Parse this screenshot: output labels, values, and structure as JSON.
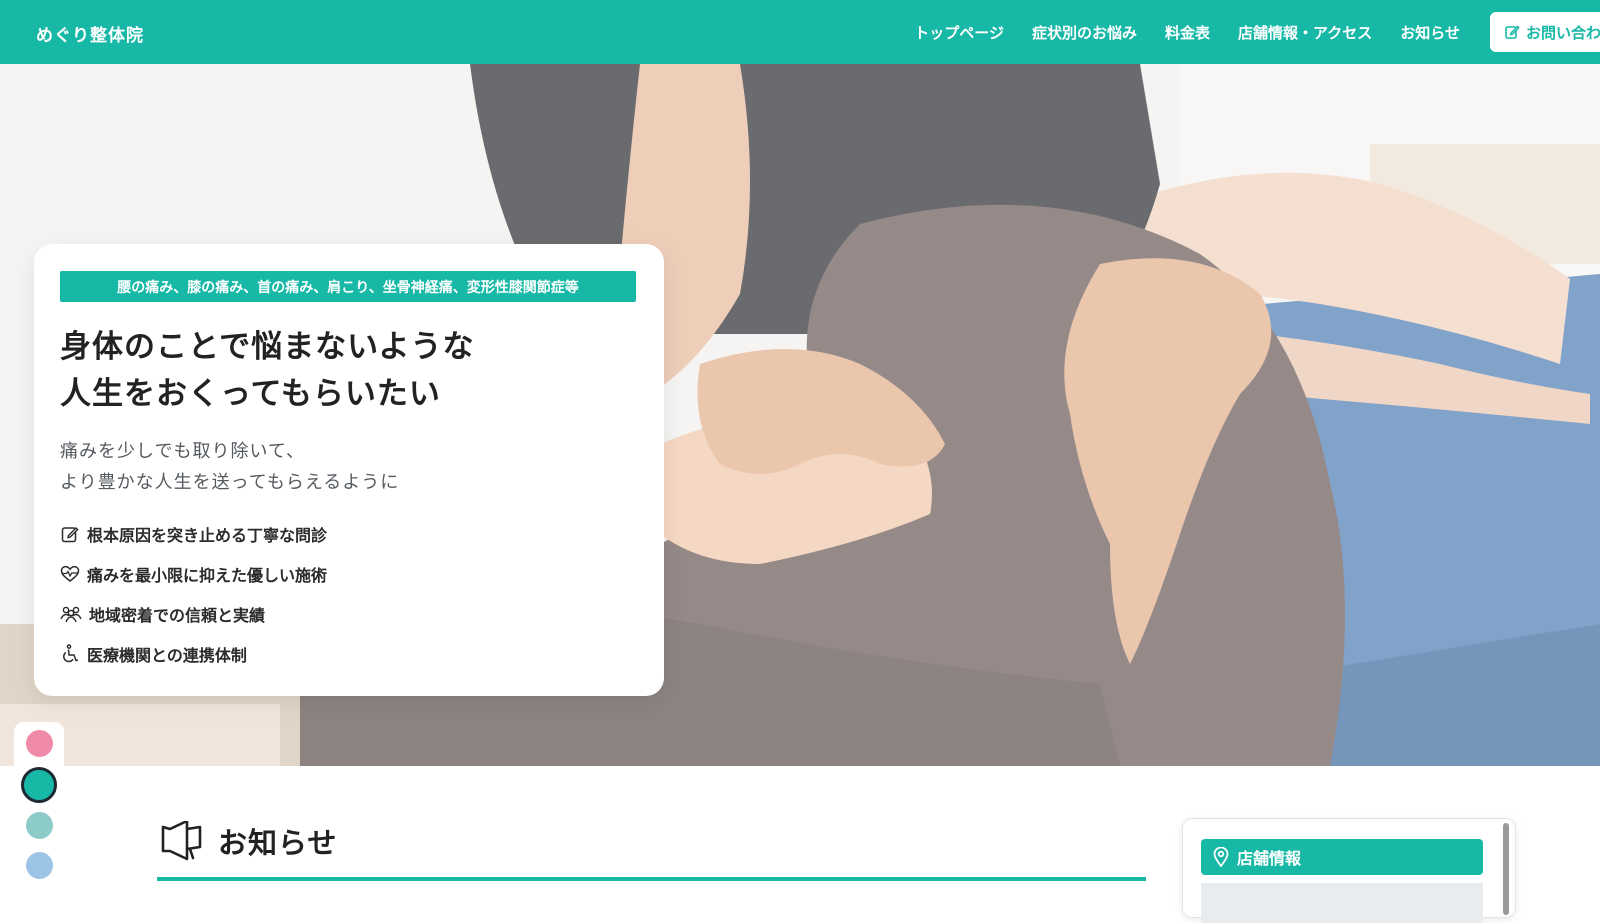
{
  "header": {
    "logo": "めぐり整体院",
    "nav": [
      "トップページ",
      "症状別のお悩み",
      "料金表",
      "店舗情報・アクセス",
      "お知らせ"
    ],
    "contact_label": "お問い合わせ"
  },
  "hero": {
    "tagline": "腰の痛み、膝の痛み、首の痛み、肩こり、坐骨神経痛、変形性膝関節症等",
    "headline_line1": "身体のことで悩まないような",
    "headline_line2": "人生をおくってもらいたい",
    "sub_line1": "痛みを少しでも取り除いて、",
    "sub_line2": "より豊かな人生を送ってもらえるように",
    "features": [
      {
        "icon": "edit-icon",
        "label": "根本原因を突き止める丁寧な問診"
      },
      {
        "icon": "heart-pulse-icon",
        "label": "痛みを最小限に抑えた優しい施術"
      },
      {
        "icon": "people-icon",
        "label": "地域密着での信頼と実績"
      },
      {
        "icon": "wheelchair-icon",
        "label": "医療機関との連携体制"
      }
    ]
  },
  "theme_swatches": [
    {
      "color": "#ef8aa8",
      "selected": false
    },
    {
      "color": "#17b8a6",
      "selected": true
    },
    {
      "color": "#8ccbc8",
      "selected": false
    },
    {
      "color": "#9cc4e6",
      "selected": false
    }
  ],
  "news": {
    "title": "お知らせ"
  },
  "store": {
    "title": "店舗情報"
  },
  "colors": {
    "accent": "#17b8a6",
    "text": "#222222"
  }
}
